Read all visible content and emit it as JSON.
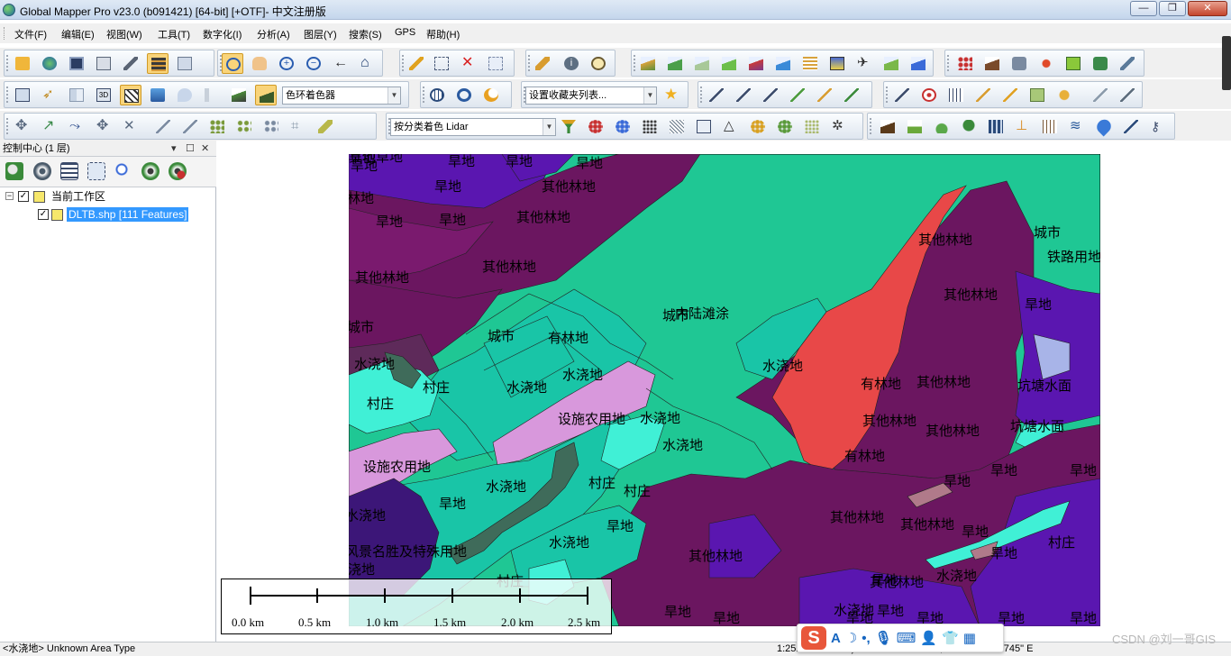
{
  "window": {
    "title": "Global Mapper Pro v23.0 (b091421) [64-bit] [+OTF]- 中文注册版"
  },
  "menu": [
    "文件(F)",
    "编辑(E)",
    "视图(W)",
    "工具(T)",
    "数字化(I)",
    "分析(A)",
    "图层(Y)",
    "搜索(S)",
    "GPS",
    "帮助(H)"
  ],
  "toolbar": {
    "shader_combo": "色环着色器",
    "favorites_combo": "设置收藏夹列表...",
    "lidar_combo": "按分类着色 Lidar"
  },
  "control_center": {
    "title": "控制中心 (1 层)",
    "tree": {
      "workspace": "当前工作区",
      "layer": "DLTB.shp [111 Features]"
    }
  },
  "map": {
    "labels": [
      "旱地",
      "旱地",
      "旱地",
      "旱地",
      "其他林地",
      "旱地",
      "旱地",
      "旱地",
      "其他林地",
      "其他林地",
      "城市",
      "铁路用地",
      "其他林地",
      "其他林地",
      "其他林地",
      "旱地",
      "其他林地",
      "城市",
      "城市",
      "有林地",
      "城市",
      "内陆滩涂",
      "水浇地",
      "村庄",
      "水浇地",
      "水浇地",
      "有林地",
      "其他林地",
      "坑塘水面",
      "村庄",
      "设施农用地",
      "水浇地",
      "水浇地",
      "其他林地",
      "其他林地",
      "坑塘水面",
      "水浇地",
      "有林地",
      "设施农用地",
      "水浇地",
      "村庄",
      "村庄",
      "旱地",
      "旱地",
      "旱地",
      "旱地",
      "水浇地",
      "其他林地",
      "其他林地",
      "水浇地",
      "旱地",
      "旱地",
      "风景名胜及特殊用地",
      "水浇地",
      "旱地",
      "其他林地",
      "村庄",
      "水浇地",
      "村庄",
      "旱地",
      "其他林地",
      "旱地",
      "旱地",
      "水浇地",
      "旱地",
      "旱地",
      "旱地",
      "旱地",
      "旱地",
      "其他草地",
      "旱地",
      "旱地",
      "旱地",
      "旱地"
    ]
  },
  "scale_bar": {
    "ticks": [
      "0.0 km",
      "0.5 km",
      "1.0 km",
      "1.5 km",
      "2.0 km",
      "2.5 km"
    ]
  },
  "status": {
    "left": "<水浇地> Unknown Area Type",
    "right": "1:2521   5479509 )   35° 33' 30.7726\" N, 104° 35' 20.1745\" E"
  },
  "watermark": "CSDN @刘一哥GIS",
  "colors": {
    "paddy": "#19c5a7",
    "dryland": "#5a16b0",
    "forest": "#6b1660",
    "city": "#1fc794",
    "woodland": "#e84848",
    "village": "#40f0d6",
    "greenhouse": "#d898dc",
    "pond": "#a8b4e8",
    "scenic": "#3c1678"
  }
}
